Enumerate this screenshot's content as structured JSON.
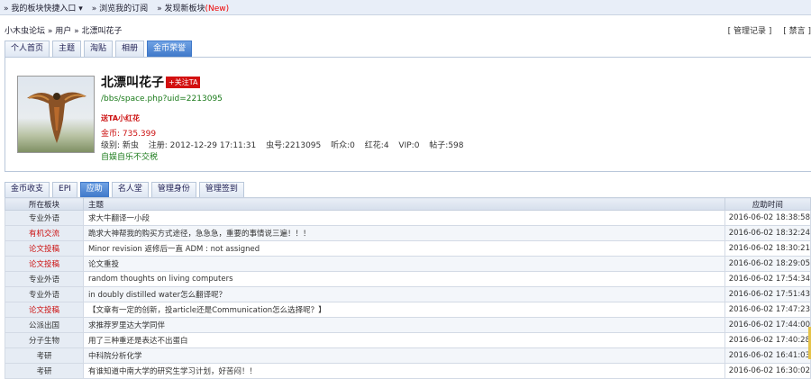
{
  "topbar": {
    "items": [
      "» 我的板块快捷入口 ▾",
      "» 浏览我的订阅",
      "» 发现新板块"
    ],
    "new_badge": "(New)"
  },
  "breadcrumb": "小木虫论坛 » 用户 » 北漂叫花子",
  "right_links": [
    "[ 管理记录 ]",
    "[ 禁言 ]"
  ],
  "tabs_top": [
    "个人首页",
    "主题",
    "淘贴",
    "相册",
    "金币荣誉"
  ],
  "tabs_top_active": 4,
  "profile": {
    "name": "北漂叫花子",
    "follow": "+关注TA",
    "url": "/bbs/space.php?uid=2213095",
    "gift": "送TA小红花",
    "coin": "金币: 735.399",
    "stats": [
      "级别: 新虫",
      "注册: 2012-12-29 17:11:31",
      "虫号:2213095",
      "听众:0",
      "红花:4",
      "VIP:0",
      "帖子:598"
    ],
    "signature": "自娱自乐不交税"
  },
  "tabs_sub": [
    "金币收支",
    "EPI",
    "应助",
    "名人堂",
    "管理身份",
    "管理签到"
  ],
  "tabs_sub_active": 2,
  "table": {
    "headers": [
      "所在板块",
      "主题",
      "应助时间"
    ],
    "rows": [
      {
        "board": "专业外语",
        "red": false,
        "title": "求大牛翻译一小段",
        "time": "2016-06-02 18:38:58"
      },
      {
        "board": "有机交流",
        "red": true,
        "title": "跪求大神帮我的购买方式途径，急急急，重要的事情说三遍！！！",
        "time": "2016-06-02 18:32:24"
      },
      {
        "board": "论文投稿",
        "red": true,
        "title": "Minor revision 返修后一直 ADM : not assigned",
        "time": "2016-06-02 18:30:21"
      },
      {
        "board": "论文投稿",
        "red": true,
        "title": "论文重投",
        "time": "2016-06-02 18:29:05"
      },
      {
        "board": "专业外语",
        "red": false,
        "title": "random thoughts on living computers",
        "time": "2016-06-02 17:54:34"
      },
      {
        "board": "专业外语",
        "red": false,
        "title": "in doubly distilled water怎么翻译呢？",
        "time": "2016-06-02 17:51:43"
      },
      {
        "board": "论文投稿",
        "red": true,
        "title": "【文章有一定的创新，投article还是Communication怎么选择呢？】",
        "time": "2016-06-02 17:47:23"
      },
      {
        "board": "公派出国",
        "red": false,
        "title": "求推荐罗里达大学同伴",
        "time": "2016-06-02 17:44:00"
      },
      {
        "board": "分子生物",
        "red": false,
        "title": "用了三种重还是表达不出蛋白",
        "time": "2016-06-02 17:40:28"
      },
      {
        "board": "考研",
        "red": false,
        "title": "中科院分析化学",
        "time": "2016-06-02 16:41:03"
      },
      {
        "board": "考研",
        "red": false,
        "title": "有谁知道中南大学的研究生学习计划，好苦闷！！",
        "time": "2016-06-02 16:30:02"
      }
    ]
  }
}
